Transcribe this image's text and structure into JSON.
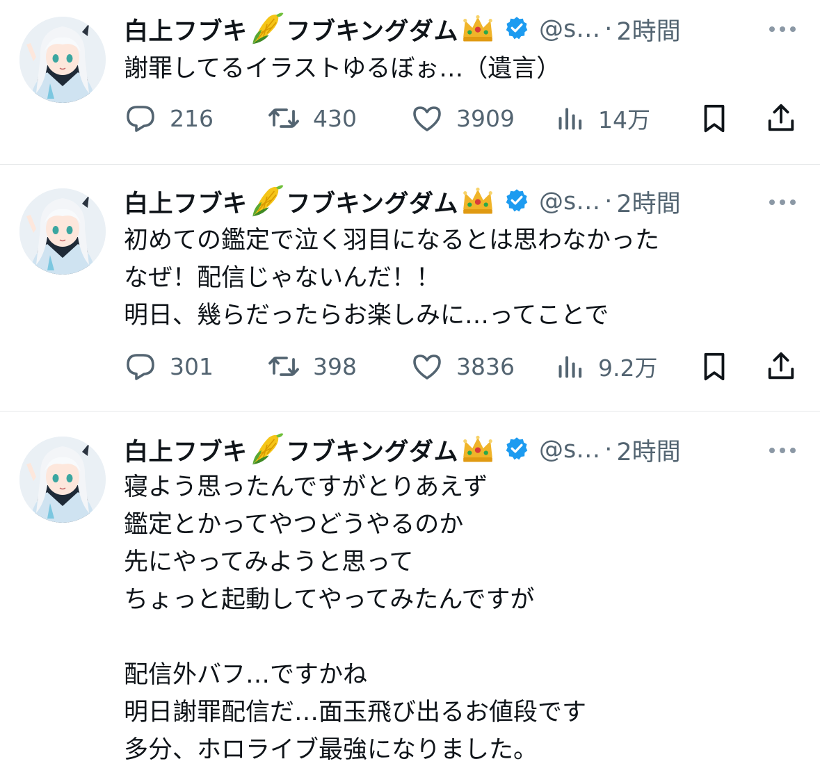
{
  "tweets": [
    {
      "name": "白上フブキ",
      "name_suffix": "フブキングダム",
      "name_emoji_1": "corn-emoji",
      "name_emoji_2": "crown-emoji",
      "handle": "@s…",
      "dot": "·",
      "time": "2時間",
      "text": "謝罪してるイラストゆるぼぉ…（遺言）",
      "reply_count": "216",
      "retweet_count": "430",
      "like_count": "3909",
      "view_count": "14万"
    },
    {
      "name": "白上フブキ",
      "name_suffix": "フブキングダム",
      "name_emoji_1": "corn-emoji",
      "name_emoji_2": "crown-emoji",
      "handle": "@s…",
      "dot": "·",
      "time": "2時間",
      "text": "初めての鑑定で泣く羽目になるとは思わなかった\nなぜ！配信じゃないんだ！！\n明日、幾らだったらお楽しみに…ってことで",
      "reply_count": "301",
      "retweet_count": "398",
      "like_count": "3836",
      "view_count": "9.2万"
    },
    {
      "name": "白上フブキ",
      "name_suffix": "フブキングダム",
      "name_emoji_1": "corn-emoji",
      "name_emoji_2": "crown-emoji",
      "handle": "@s…",
      "dot": "·",
      "time": "2時間",
      "text": "寝よう思ったんですがとりあえず\n鑑定とかってやつどうやるのか\n先にやってみようと思って\nちょっと起動してやってみたんですが\n\n配信外バフ…ですかね\n明日謝罪配信だ…面玉飛び出るお値段です\n多分、ホロライブ最強になりました。"
    }
  ],
  "colors": {
    "text": "#0f1419",
    "secondary": "#536471",
    "verified": "#1d9bf0",
    "divider": "#e7e9ea"
  }
}
